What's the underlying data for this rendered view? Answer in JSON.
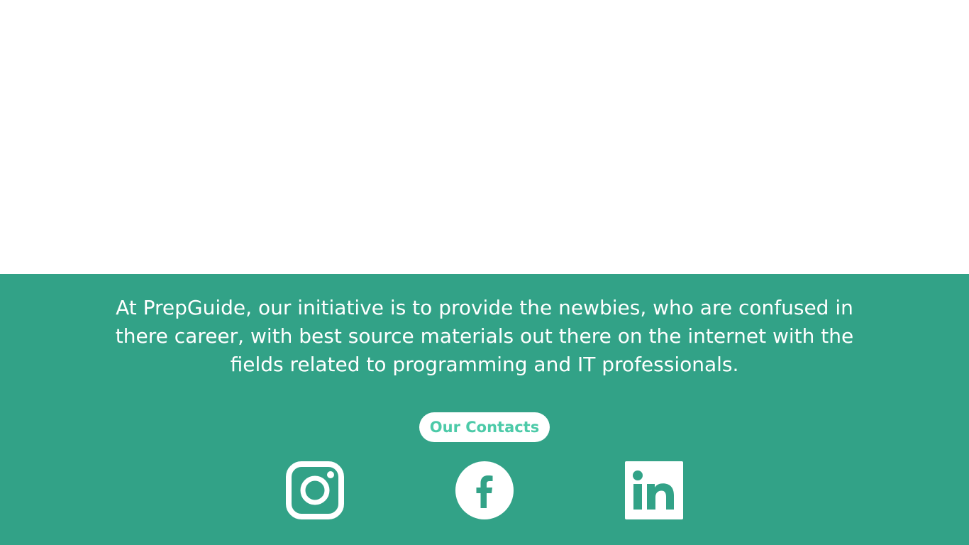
{
  "about": {
    "text": "At PrepGuide, our initiative is to provide the newbies, who are confused in there career, with best source materials out there on the internet with the fields related to programming and IT professionals."
  },
  "contacts": {
    "button_label": "Our Contacts"
  },
  "social_links": [
    {
      "name": "instagram",
      "icon": "instagram-icon"
    },
    {
      "name": "facebook",
      "icon": "facebook-icon"
    },
    {
      "name": "linkedin",
      "icon": "linkedin-icon"
    }
  ],
  "colors": {
    "footer_background": "#32a287",
    "accent_text": "#4ccaa8",
    "foreground": "#ffffff"
  }
}
